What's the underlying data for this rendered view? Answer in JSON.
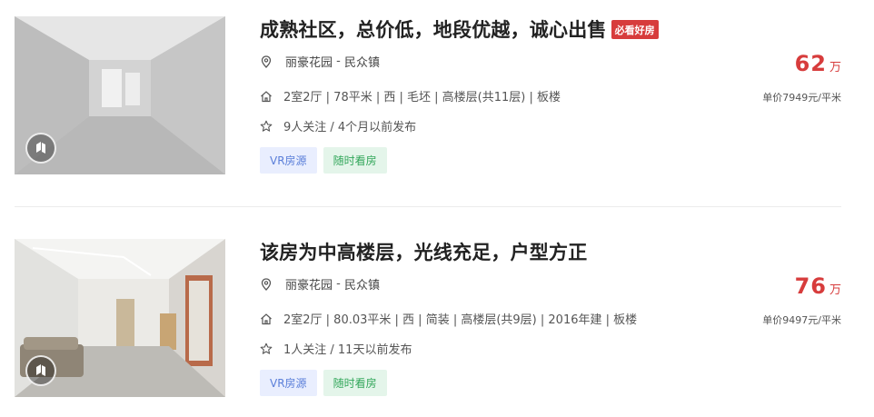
{
  "listings": [
    {
      "title": "成熟社区，总价低，地段优越，诚心出售",
      "badge": "必看好房",
      "community": "丽豪花园",
      "separator": " - ",
      "area": "民众镇",
      "house_info": "2室2厅 | 78平米 | 西 | 毛坯 | 高楼层(共11层) | 板楼",
      "follow_info": "9人关注 / 4个月以前发布",
      "tags": [
        "VR房源",
        "随时看房"
      ],
      "total_price": "62",
      "price_unit": "万",
      "unit_price": "单价7949元/平米"
    },
    {
      "title": "该房为中高楼层，光线充足，户型方正",
      "badge": "",
      "community": "丽豪花园",
      "separator": " - ",
      "area": "民众镇",
      "house_info": "2室2厅 | 80.03平米 | 西 | 简装 | 高楼层(共9层) | 2016年建 | 板楼",
      "follow_info": "1人关注 / 11天以前发布",
      "tags": [
        "VR房源",
        "随时看房"
      ],
      "total_price": "76",
      "price_unit": "万",
      "unit_price": "单价9497元/平米"
    }
  ],
  "icons": {
    "location": "map-pin-icon",
    "house": "house-icon",
    "follow": "star-icon",
    "vr": "vr-badge-icon"
  },
  "colors": {
    "price": "#d73c3c",
    "vr_tag_bg": "#e9eefe",
    "vr_tag_text": "#5b7fd9",
    "visit_tag_bg": "#e4f5ea",
    "visit_tag_text": "#33a75b",
    "badge_bg": "#d73c3c"
  }
}
